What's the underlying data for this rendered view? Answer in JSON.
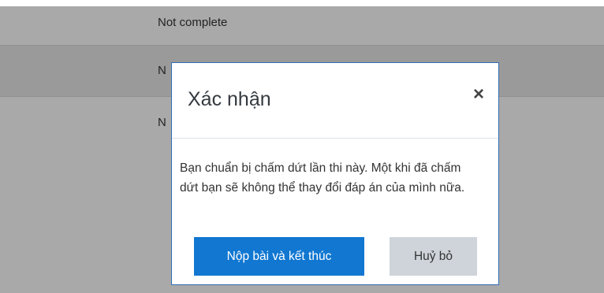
{
  "background_rows": [
    {
      "status": "Not complete"
    },
    {
      "status": "N"
    },
    {
      "status": "N"
    }
  ],
  "dialog": {
    "title": "Xác nhận",
    "close_glyph": "×",
    "body": "Bạn chuẩn bị chấm dứt lần thi này. Một khi đã chấm dứt bạn sẽ không thể thay đổi đáp án của mình nữa.",
    "submit_label": "Nộp bài và kết thúc",
    "cancel_label": "Huỷ bỏ"
  },
  "colors": {
    "primary": "#1177d1",
    "secondary": "#ced4da",
    "overlay_row": "#a9a9a9",
    "overlay_row_alt": "#9a9a9a"
  }
}
